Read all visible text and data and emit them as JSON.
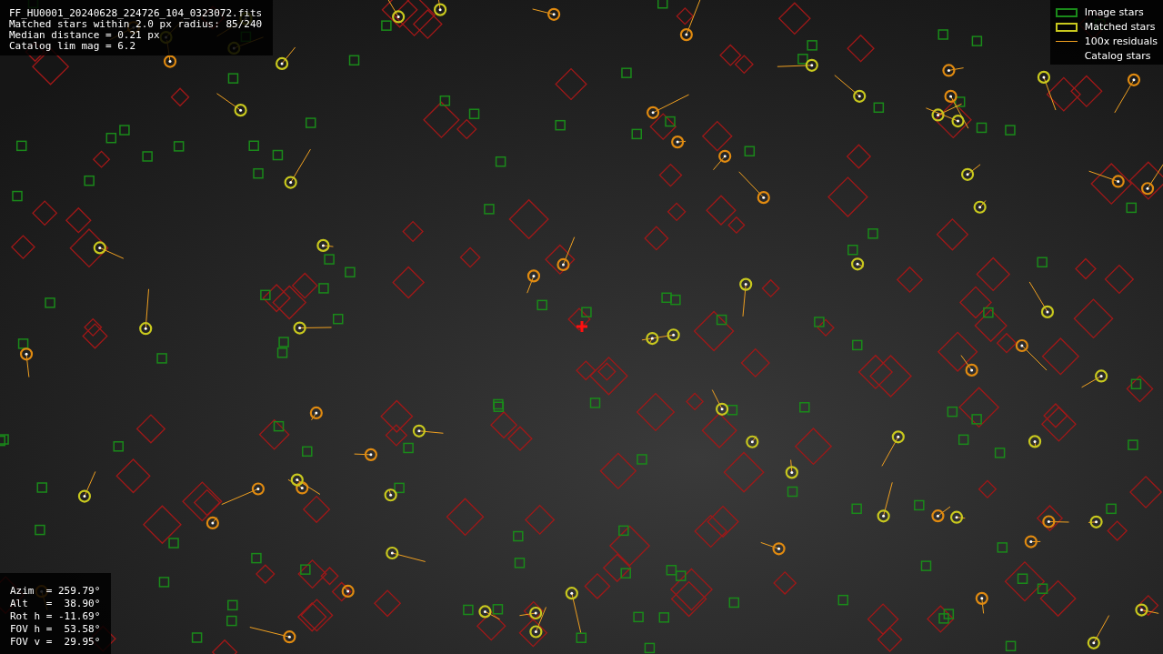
{
  "info": {
    "lines": [
      "FF_HU0001_20240628_224726_104_0323072.fits",
      "Matched stars within 2.0 px radius: 85/240",
      "Median distance = 0.21 px",
      "Catalog lim mag = 6.2"
    ]
  },
  "legend": [
    {
      "kind": "box",
      "color": "#1a8a1a",
      "label": "Image stars"
    },
    {
      "kind": "box",
      "color": "#c8c81e",
      "label": "Matched stars"
    },
    {
      "kind": "line",
      "color": "#f0a020",
      "label": "100x residuals"
    },
    {
      "kind": "none",
      "label": "Catalog stars"
    }
  ],
  "pointing": {
    "lines": [
      "Azim  = 259.79°",
      "Alt   =  38.90°",
      "Rot h = -11.69°",
      "FOV h =  53.58°",
      "FOV v =  29.95°"
    ]
  }
}
